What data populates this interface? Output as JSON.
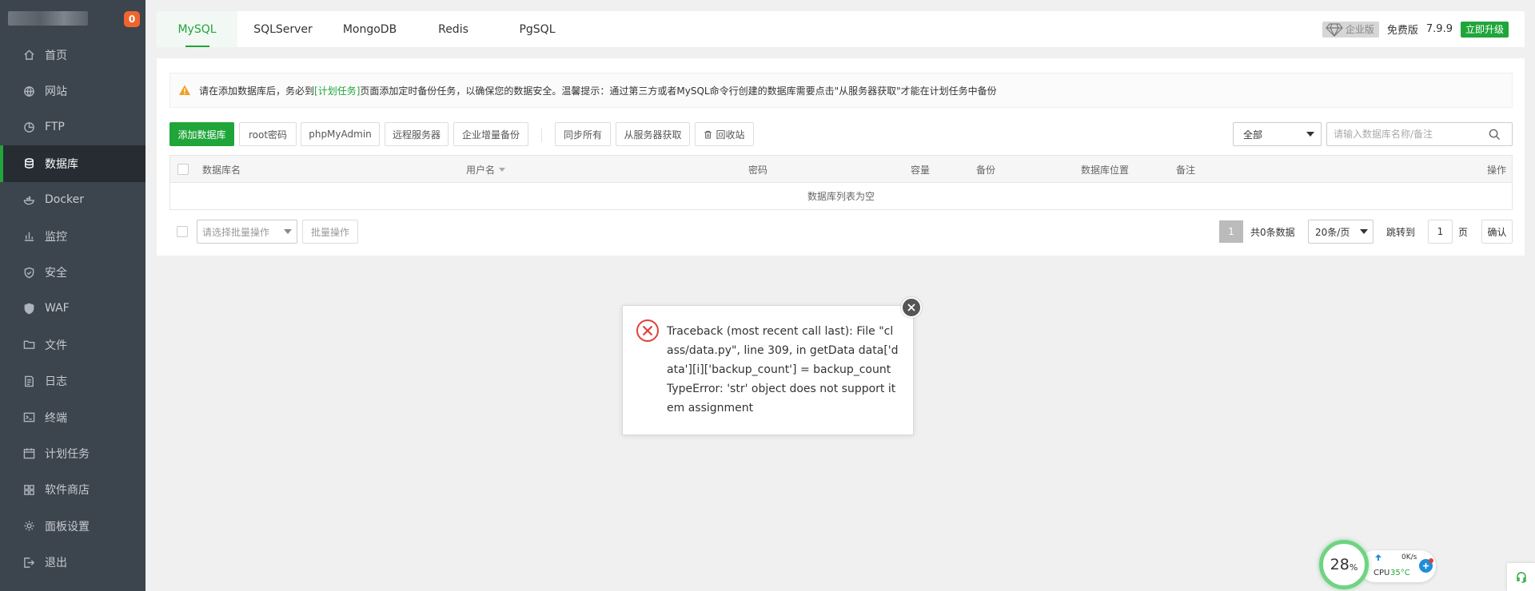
{
  "sidebar": {
    "badge": "0",
    "items": [
      {
        "label": "首页",
        "icon": "home-icon"
      },
      {
        "label": "网站",
        "icon": "globe-icon"
      },
      {
        "label": "FTP",
        "icon": "ftp-icon"
      },
      {
        "label": "数据库",
        "icon": "database-icon"
      },
      {
        "label": "Docker",
        "icon": "docker-icon"
      },
      {
        "label": "监控",
        "icon": "monitor-icon"
      },
      {
        "label": "安全",
        "icon": "shield-icon"
      },
      {
        "label": "WAF",
        "icon": "waf-shield-icon"
      },
      {
        "label": "文件",
        "icon": "folder-icon"
      },
      {
        "label": "日志",
        "icon": "log-icon"
      },
      {
        "label": "终端",
        "icon": "terminal-icon"
      },
      {
        "label": "计划任务",
        "icon": "calendar-icon"
      },
      {
        "label": "软件商店",
        "icon": "grid-icon"
      },
      {
        "label": "面板设置",
        "icon": "gear-icon"
      },
      {
        "label": "退出",
        "icon": "logout-icon"
      }
    ]
  },
  "tabs": [
    "MySQL",
    "SQLServer",
    "MongoDB",
    "Redis",
    "PgSQL"
  ],
  "header": {
    "enterprise": "企业版",
    "free": "免费版",
    "version": "7.9.9",
    "upgrade": "立即升级"
  },
  "notice": {
    "pre": "请在添加数据库后，务必到",
    "link": "[计划任务]",
    "post": "页面添加定时备份任务，以确保您的数据安全。温馨提示：通过第三方或者MySQL命令行创建的数据库需要点击\"从服务器获取\"才能在计划任务中备份"
  },
  "toolbar": {
    "add_db": "添加数据库",
    "root_pwd": "root密码",
    "phpmyadmin": "phpMyAdmin",
    "remote": "远程服务器",
    "enterprise_backup": "企业增量备份",
    "sync_all": "同步所有",
    "fetch_server": "从服务器获取",
    "recycle": "回收站",
    "filter_selected": "全部",
    "search_placeholder": "请输入数据库名称/备注"
  },
  "table": {
    "columns": [
      "数据库名",
      "用户名",
      "密码",
      "容量",
      "备份",
      "数据库位置",
      "备注",
      "操作"
    ],
    "empty": "数据库列表为空"
  },
  "footer": {
    "batch_placeholder": "请选择批量操作",
    "batch_button": "批量操作",
    "page": "1",
    "total": "共0条数据",
    "per_page": "20条/页",
    "jump_to": "跳转到",
    "jump_value": "1",
    "page_unit": "页",
    "confirm": "确认"
  },
  "dialog": {
    "message": "Traceback (most recent call last): File \"class/data.py\", line 309, in getData data['data'][i]['backup_count'] = backup_count TypeError: 'str' object does not support item assignment"
  },
  "cpu": {
    "percent": "28",
    "unit": "%",
    "net": "0K/s",
    "label": "CPU",
    "temp": "35°C"
  },
  "colors": {
    "brand_green": "#20a53a",
    "sidebar_bg": "#3c444d",
    "badge_orange": "#f0642d",
    "error_red": "#e0403a"
  }
}
